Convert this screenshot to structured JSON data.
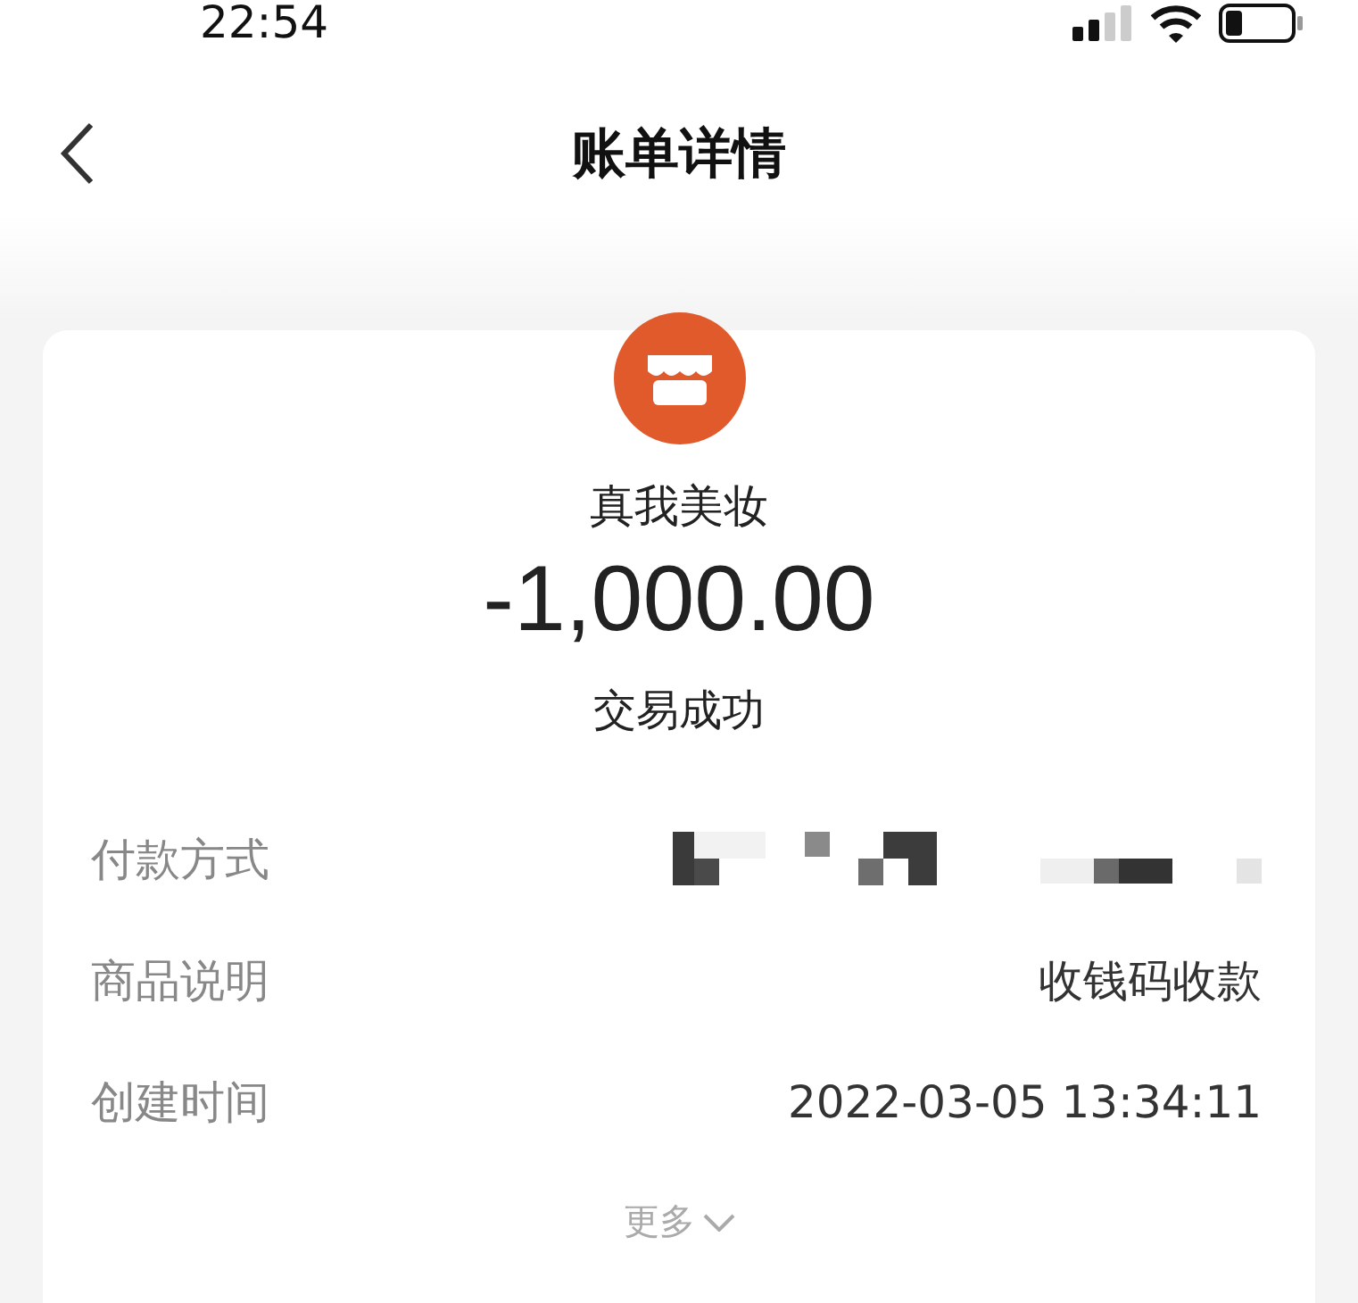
{
  "status_bar": {
    "time": "22:54"
  },
  "nav": {
    "title": "账单详情"
  },
  "bill": {
    "merchant": "真我美妆",
    "amount": "-1,000.00",
    "status": "交易成功"
  },
  "details": [
    {
      "kind": "redacted",
      "label": "付款方式"
    },
    {
      "kind": "text",
      "label": "商品说明",
      "value": "收钱码收款"
    },
    {
      "kind": "text",
      "label": "创建时间",
      "value": "2022-03-05 13:34:11"
    }
  ],
  "more": {
    "label": "更多"
  }
}
